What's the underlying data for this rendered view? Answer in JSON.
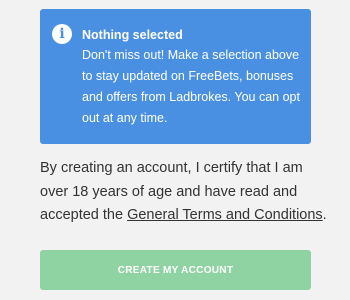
{
  "notice": {
    "icon": "info-icon",
    "icon_glyph": "i",
    "title": "Nothing selected",
    "body": "Don't miss out! Make a selection above to stay updated on FreeBets, bonuses and offers from Ladbrokes. You can opt out at any time.",
    "background_color": "#4a90e2"
  },
  "terms": {
    "text_before": "By creating an account, I certify that I am over 18 years of age and have read and accepted the ",
    "link_label": "General Terms and Conditions",
    "text_after": "."
  },
  "cta": {
    "label": "CREATE MY ACCOUNT",
    "color": "#8fd3a3"
  }
}
